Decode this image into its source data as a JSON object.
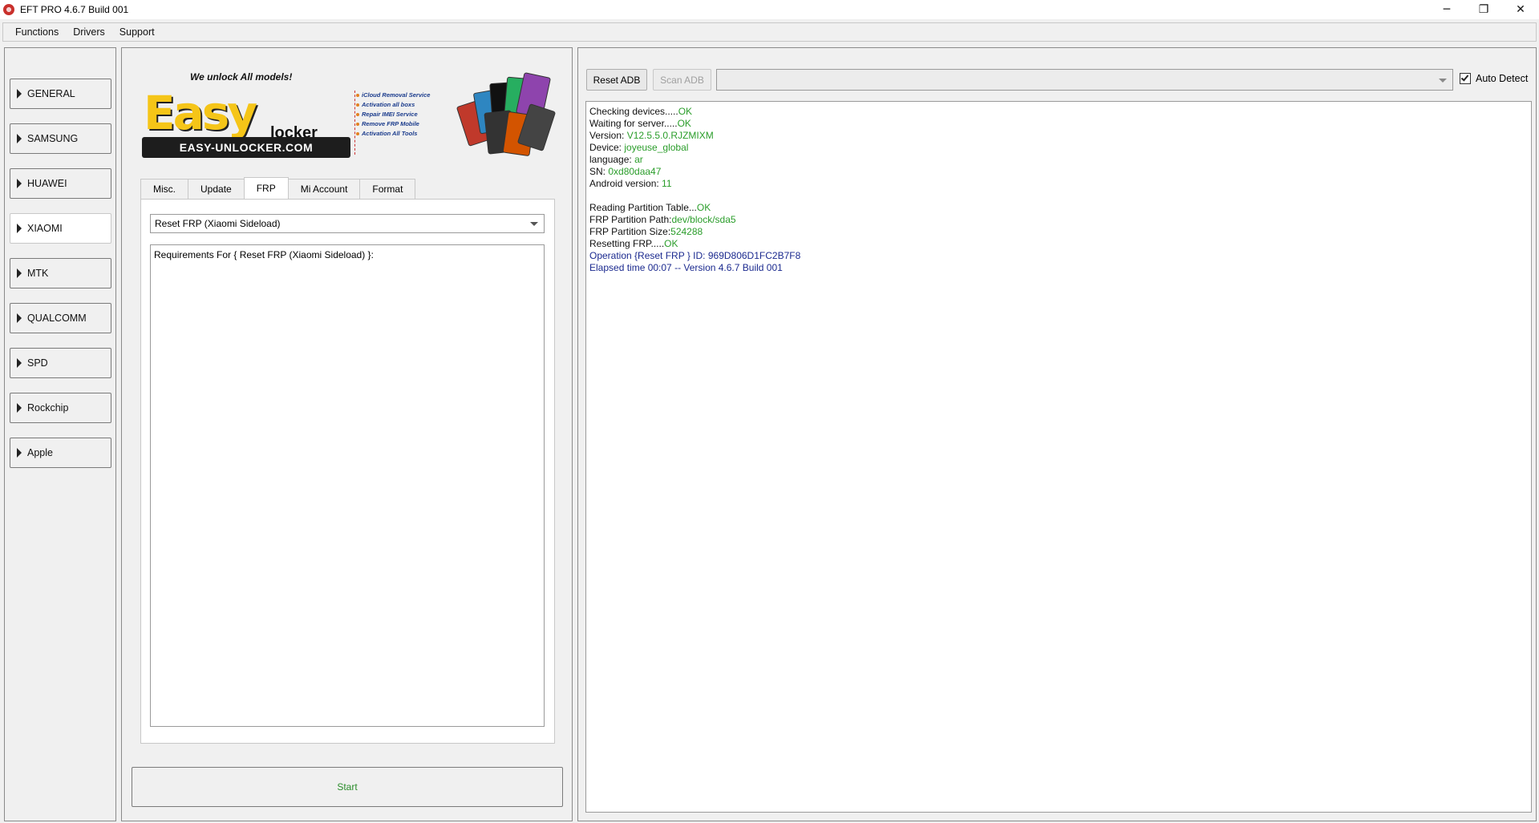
{
  "window": {
    "title": "EFT PRO 4.6.7 Build 001",
    "minimize": "─",
    "maximize": "❐",
    "close": "✕"
  },
  "menu": [
    "Functions",
    "Drivers",
    "Support"
  ],
  "sidebar": {
    "items": [
      {
        "label": "GENERAL"
      },
      {
        "label": "SAMSUNG"
      },
      {
        "label": "HUAWEI"
      },
      {
        "label": "XIAOMI",
        "active": true
      },
      {
        "label": "MTK"
      },
      {
        "label": "QUALCOMM"
      },
      {
        "label": "SPD"
      },
      {
        "label": "Rockchip"
      },
      {
        "label": "Apple"
      }
    ]
  },
  "banner": {
    "headline": "We unlock All models!",
    "brand": "Easy",
    "sub": "locker",
    "url": "EASY-UNLOCKER.COM",
    "services": [
      "iCloud Removal Service",
      "Activation all boxs",
      "Repair IMEI Service",
      "Remove FRP Mobile",
      "Activation All Tools"
    ]
  },
  "tabs": [
    {
      "label": "Misc."
    },
    {
      "label": "Update"
    },
    {
      "label": "FRP",
      "active": true
    },
    {
      "label": "Mi Account"
    },
    {
      "label": "Format"
    }
  ],
  "frp": {
    "selected_operation": "Reset FRP  (Xiaomi Sideload)",
    "requirements": "Requirements For { Reset FRP  (Xiaomi Sideload) }:"
  },
  "start_label": "Start",
  "adb": {
    "reset_label": "Reset ADB",
    "scan_label": "Scan ADB",
    "device_combo_value": "",
    "auto_detect_label": "Auto Detect",
    "auto_detect_checked": true
  },
  "log": [
    {
      "k": "Checking devices.....",
      "v": "OK",
      "c": "green"
    },
    {
      "k": "Waiting for server.....",
      "v": "OK",
      "c": "green"
    },
    {
      "k": "Version: ",
      "v": "V12.5.5.0.RJZMIXM",
      "c": "green"
    },
    {
      "k": "Device: ",
      "v": "joyeuse_global",
      "c": "green"
    },
    {
      "k": "language: ",
      "v": "ar",
      "c": "green"
    },
    {
      "k": "SN: ",
      "v": "0xd80daa47",
      "c": "green"
    },
    {
      "k": "Android version: ",
      "v": "11",
      "c": "green"
    },
    {
      "k": "",
      "v": "",
      "c": "green"
    },
    {
      "k": "Reading Partition Table...",
      "v": "OK",
      "c": "green"
    },
    {
      "k": "FRP Partition Path:",
      "v": "dev/block/sda5",
      "c": "green"
    },
    {
      "k": "FRP Partition Size:",
      "v": "524288",
      "c": "green"
    },
    {
      "k": "Resetting FRP.....",
      "v": "OK",
      "c": "green"
    },
    {
      "k": "",
      "v": "Operation {Reset FRP } ID: 969D806D1FC2B7F8",
      "c": "blue"
    },
    {
      "k": "",
      "v": "Elapsed time 00:07 -- Version 4.6.7 Build 001",
      "c": "blue"
    }
  ],
  "colors": {
    "ok_green": "#2a9d2a",
    "info_blue": "#1b2a8f",
    "start_green": "#2a8c2a",
    "brand_yellow": "#f5c518"
  }
}
